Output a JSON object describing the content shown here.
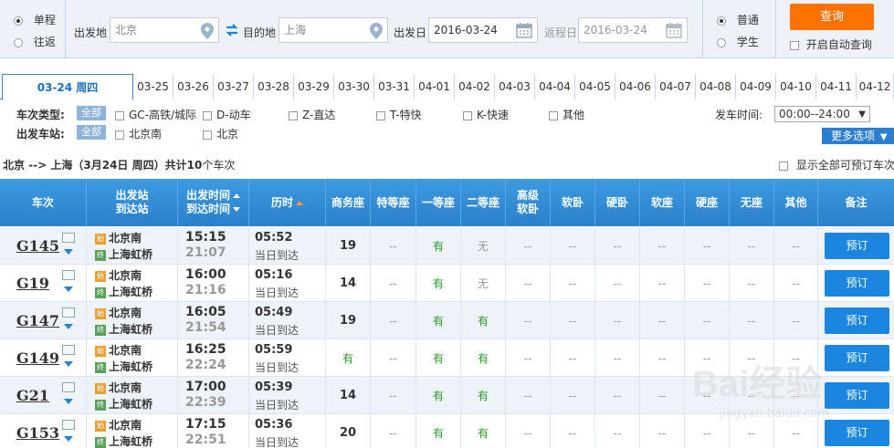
{
  "search": {
    "trip_types": [
      "单程",
      "往返"
    ],
    "from_label": "出发地",
    "from_value": "北京",
    "to_label": "目的地",
    "to_value": "上海",
    "depart_label": "出发日",
    "depart_value": "2016-03-24",
    "return_label": "返程日",
    "return_value": "2016-03-24",
    "passenger_types": [
      "普通",
      "学生"
    ],
    "query_label": "查询",
    "auto_query_label": "开启自动查询"
  },
  "date_tabs": [
    "03-24 周四",
    "03-25",
    "03-26",
    "03-27",
    "03-28",
    "03-29",
    "03-30",
    "03-31",
    "04-01",
    "04-02",
    "04-03",
    "04-04",
    "04-05",
    "04-06",
    "04-07",
    "04-08",
    "04-09",
    "04-10",
    "04-11",
    "04-12"
  ],
  "filters": {
    "train_type_label": "车次类型:",
    "all_label": "全部",
    "train_types": [
      "GC-高铁/城际",
      "D-动车",
      "Z-直达",
      "T-特快",
      "K-快速",
      "其他"
    ],
    "station_label": "出发车站:",
    "stations": [
      "北京南",
      "北京"
    ],
    "time_label": "发车时间:",
    "time_value": "00:00--24:00",
    "more_label": "更多选项"
  },
  "summary": {
    "route": "北京 --> 上海（3月24日 周四）共计",
    "count": "10",
    "suffix": "个车次",
    "show_all_label": "显示全部可预订车次"
  },
  "table": {
    "headers": {
      "train": "车次",
      "station_from": "出发站",
      "station_to": "到达站",
      "time_from": "出发时间",
      "time_to": "到达时间",
      "duration": "历时",
      "business": "商务座",
      "special": "特等座",
      "first": "一等座",
      "second": "二等座",
      "premium_soft1": "高级",
      "premium_soft2": "软卧",
      "soft_sleeper": "软卧",
      "hard_sleeper": "硬卧",
      "soft_seat": "软座",
      "hard_seat": "硬座",
      "no_seat": "无座",
      "other": "其他",
      "remark": "备注"
    },
    "start_tag": "始",
    "end_tag": "终",
    "book_label": "预订",
    "rows": [
      {
        "no": "G145",
        "from": "北京南",
        "to": "上海虹桥",
        "dep": "15:15",
        "arr": "21:07",
        "dur": "05:52",
        "note": "当日到达",
        "business": "19",
        "special": "--",
        "first": "有",
        "second": "无"
      },
      {
        "no": "G19",
        "from": "北京南",
        "to": "上海虹桥",
        "dep": "16:00",
        "arr": "21:16",
        "dur": "05:16",
        "note": "当日到达",
        "business": "14",
        "special": "--",
        "first": "有",
        "second": "无"
      },
      {
        "no": "G147",
        "from": "北京南",
        "to": "上海虹桥",
        "dep": "16:05",
        "arr": "21:54",
        "dur": "05:49",
        "note": "当日到达",
        "business": "19",
        "special": "--",
        "first": "有",
        "second": "有"
      },
      {
        "no": "G149",
        "from": "北京南",
        "to": "上海虹桥",
        "dep": "16:25",
        "arr": "22:24",
        "dur": "05:59",
        "note": "当日到达",
        "business": "有",
        "special": "--",
        "first": "有",
        "second": "有"
      },
      {
        "no": "G21",
        "from": "北京南",
        "to": "上海虹桥",
        "dep": "17:00",
        "arr": "22:39",
        "dur": "05:39",
        "note": "当日到达",
        "business": "14",
        "special": "--",
        "first": "有",
        "second": "有"
      },
      {
        "no": "G153",
        "from": "北京南",
        "to": "上海虹桥",
        "dep": "17:15",
        "arr": "22:51",
        "dur": "05:36",
        "note": "当日到达",
        "business": "20",
        "special": "--",
        "first": "有",
        "second": "有"
      }
    ],
    "dash": "--"
  },
  "watermark": {
    "text": "Bai经验",
    "url": "jingyan.baidu.com"
  },
  "colors": {
    "accent": "#2a7fca",
    "query": "#ff7200",
    "available": "#2a9a2a"
  }
}
